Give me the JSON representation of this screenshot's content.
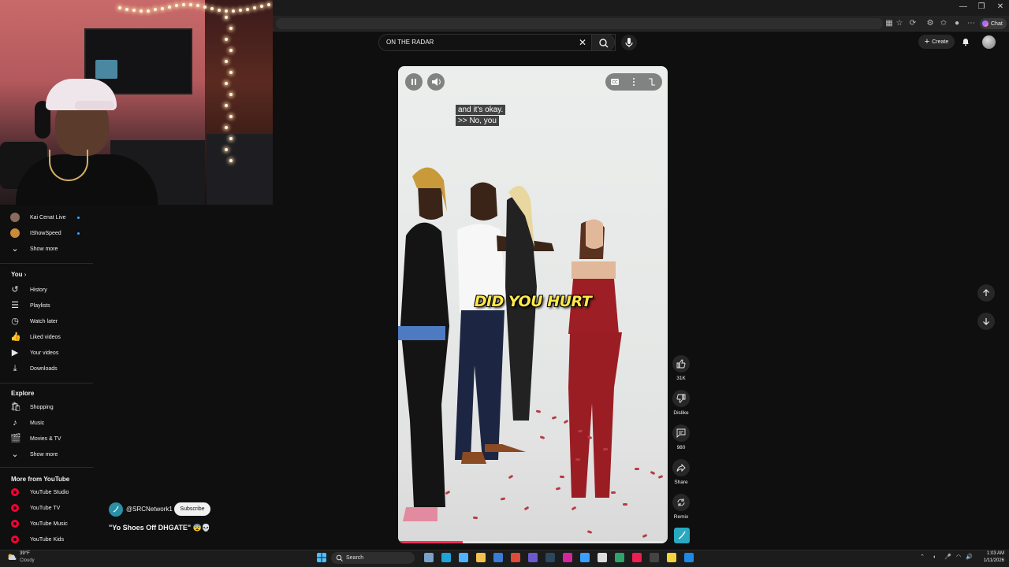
{
  "browser": {
    "chat_label": "Chat"
  },
  "search": {
    "query": "ON THE RADAR",
    "clear_glyph": "✕"
  },
  "header": {
    "create_label": "Create"
  },
  "sidebar": {
    "subscriptions": [
      {
        "label": "Kai Cenat Live",
        "avatar_color": "#8b6b5b",
        "live": true
      },
      {
        "label": "IShowSpeed",
        "avatar_color": "#c98a3a",
        "live": true
      }
    ],
    "show_more_1": "Show more",
    "you_heading": "You",
    "you_items": [
      {
        "label": "History",
        "icon": "history-icon",
        "glyph": "↺"
      },
      {
        "label": "Playlists",
        "icon": "playlists-icon",
        "glyph": "☰"
      },
      {
        "label": "Watch later",
        "icon": "watch-later-icon",
        "glyph": "◷"
      },
      {
        "label": "Liked videos",
        "icon": "thumbs-up-icon",
        "glyph": "👍"
      },
      {
        "label": "Your videos",
        "icon": "your-videos-icon",
        "glyph": "▶"
      },
      {
        "label": "Downloads",
        "icon": "download-icon",
        "glyph": "⤓"
      }
    ],
    "explore_heading": "Explore",
    "explore_items": [
      {
        "label": "Shopping",
        "icon": "shopping-bag-icon",
        "glyph": "🛍"
      },
      {
        "label": "Music",
        "icon": "music-note-icon",
        "glyph": "♪"
      },
      {
        "label": "Movies & TV",
        "icon": "clapperboard-icon",
        "glyph": "🎬"
      }
    ],
    "show_more_2": "Show more",
    "more_heading": "More from YouTube",
    "more_items": [
      {
        "label": "YouTube Studio"
      },
      {
        "label": "YouTube TV"
      },
      {
        "label": "YouTube Music"
      },
      {
        "label": "YouTube Kids"
      }
    ]
  },
  "video": {
    "captions": [
      "and it's okay.",
      ">> No, you"
    ],
    "overlay_text": "DID YOU HURT",
    "progress_fraction": 0.24,
    "progress_color": "#ff2d55"
  },
  "channel": {
    "handle": "@SRCNetwork1",
    "subscribe_label": "Subscribe",
    "title": "\"Yo Shoes Off DHGATE\" 😨💀"
  },
  "actions": {
    "likes": "31K",
    "dislike_label": "Dislike",
    "comments": "980",
    "share_label": "Share",
    "remix_label": "Remix"
  },
  "taskbar": {
    "temperature": "39°F",
    "weather": "Cloudy",
    "search_label": "Search",
    "time": "1:03 AM",
    "date": "1/11/2026"
  },
  "colors": {
    "accent_red": "#ff0033",
    "live_blue": "#3ea6ff",
    "caption_yellow": "#ffe94a"
  }
}
